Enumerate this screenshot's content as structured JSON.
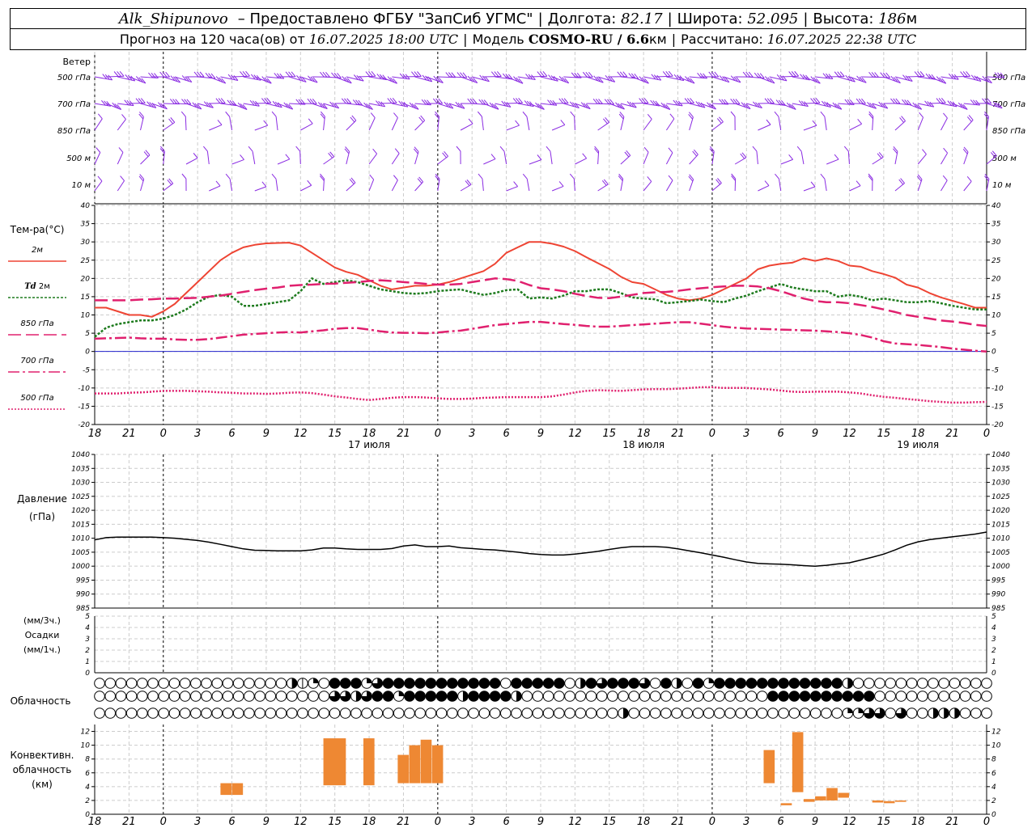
{
  "header": {
    "station": "Alk_Shipunovo",
    "provider": "– Предоставлено ФГБУ \"ЗапСиб УГМС\"",
    "lon_label": "Долгота:",
    "lon_value": "82.17",
    "lat_label": "Широта:",
    "lat_value": "52.095",
    "alt_label": "Высота:",
    "alt_value": "186",
    "alt_unit": "м",
    "forecast_label": "Прогноз на 120 часа(ов) от",
    "forecast_time": "16.07.2025 18:00 UTC",
    "model_label": "Модель",
    "model_name": "COSMO-RU / 6.6",
    "model_unit": "км",
    "calc_label": "Рассчитано:",
    "calc_time": "16.07.2025 22:38 UTC"
  },
  "time_axis": {
    "hour_labels": [
      "18",
      "21",
      "0",
      "3",
      "6",
      "9",
      "12",
      "15",
      "18",
      "21",
      "0",
      "3",
      "6",
      "9",
      "12",
      "15",
      "18",
      "21",
      "0",
      "3",
      "6",
      "9",
      "12",
      "15",
      "18",
      "21",
      "0"
    ],
    "day_labels": [
      {
        "text": "17 июля",
        "tick": 8
      },
      {
        "text": "18 июля",
        "tick": 16
      },
      {
        "text": "19 июля",
        "tick": 24
      }
    ],
    "midnight_ticks": [
      2,
      10,
      18,
      26
    ]
  },
  "wind_panel": {
    "title": "Ветер",
    "levels": [
      "500 гПа",
      "700 гПа",
      "850 гПа",
      "500 м",
      "10 м"
    ],
    "colors": {
      "barb": "#8a2be2"
    }
  },
  "chart_data": [
    {
      "type": "line",
      "title": "Тем-ра(°C)",
      "ylim": [
        -20,
        40
      ],
      "yticks": [
        -20,
        -15,
        -10,
        -5,
        0,
        5,
        10,
        15,
        20,
        25,
        30,
        35,
        40
      ],
      "x_hours": [
        0,
        78
      ],
      "series": [
        {
          "name": "2м",
          "color": "#ee4433",
          "dash": "",
          "width": 2,
          "values": [
            12,
            12,
            11,
            10,
            10,
            9.5,
            11,
            13,
            16,
            19,
            22,
            25,
            27,
            28.5,
            29.2,
            29.6,
            29.7,
            29.8,
            29,
            27,
            25,
            23,
            21.8,
            21,
            19.5,
            18,
            17,
            17.5,
            18,
            18,
            18.3,
            19,
            20,
            21,
            22,
            24,
            27,
            28.5,
            30,
            30,
            29.5,
            28.7,
            27.5,
            25.8,
            24.2,
            22.6,
            20.5,
            19,
            18.5,
            17,
            15.5,
            14.5,
            14,
            14.5,
            15.5,
            17,
            18.5,
            20,
            22.5,
            23.5,
            24,
            24.3,
            25.5,
            24.8,
            25.5,
            24.8,
            23.5,
            23.2,
            22,
            21.2,
            20.2,
            18.3,
            17.5,
            16,
            14.8,
            13.9,
            13,
            12,
            12
          ]
        },
        {
          "name": "Td 2м",
          "color": "#1e7b1e",
          "dash": "3,2",
          "width": 2.5,
          "values": [
            4,
            6.5,
            7.5,
            8,
            8.5,
            8.5,
            9,
            10,
            11.5,
            13.5,
            15,
            15.5,
            15,
            12.5,
            12.5,
            13,
            13.5,
            14,
            16.5,
            20,
            18.5,
            19,
            19.5,
            19,
            18,
            17,
            16.5,
            16,
            15.8,
            16,
            16.5,
            16.8,
            17,
            16.2,
            15.5,
            16,
            16.8,
            17,
            14.5,
            14.8,
            14.5,
            15.3,
            16.5,
            16.5,
            17,
            17,
            16,
            14.8,
            14.5,
            14.3,
            13.2,
            13.5,
            13.8,
            14.2,
            13.8,
            13.5,
            14.5,
            15.3,
            16.5,
            17.5,
            18.5,
            17.5,
            17,
            16.5,
            16.5,
            15,
            15.5,
            15,
            14,
            14.5,
            14,
            13.5,
            13.5,
            13.8,
            13.2,
            12.5,
            12,
            11.5,
            11.5
          ]
        },
        {
          "name": "850 гПа",
          "color": "#e0206e",
          "dash": "16,6",
          "width": 2.5,
          "values": [
            14,
            14,
            14,
            14,
            14.2,
            14.3,
            14.5,
            14.5,
            14.6,
            14.7,
            15,
            15.3,
            15.8,
            16.3,
            16.8,
            17.2,
            17.5,
            18,
            18.2,
            18.3,
            18.5,
            18.6,
            18.8,
            19,
            19.3,
            19.5,
            19.3,
            19,
            18.8,
            18.5,
            18.3,
            18.3,
            18.5,
            19,
            19.5,
            20,
            19.8,
            19.3,
            18.2,
            17.3,
            17,
            16.5,
            15.8,
            15.2,
            14.7,
            14.6,
            15,
            15.5,
            16,
            16.2,
            16.3,
            16.6,
            17,
            17.3,
            17.6,
            17.8,
            18,
            18,
            17.8,
            17.3,
            16.5,
            15.5,
            14.5,
            13.8,
            13.5,
            13.5,
            13.2,
            12.7,
            12.2,
            11.5,
            10.8,
            10,
            9.5,
            9,
            8.5,
            8.2,
            7.8,
            7.3,
            7
          ]
        },
        {
          "name": "700 гПа",
          "color": "#e0206e",
          "dash": "14,4,3,4",
          "width": 2.5,
          "values": [
            3.5,
            3.6,
            3.7,
            3.8,
            3.6,
            3.5,
            3.5,
            3.3,
            3.2,
            3.2,
            3.4,
            3.8,
            4.2,
            4.6,
            4.8,
            5,
            5.2,
            5.3,
            5.2,
            5.5,
            5.8,
            6.2,
            6.4,
            6.4,
            6,
            5.5,
            5.2,
            5.1,
            5.1,
            5,
            5.2,
            5.5,
            5.7,
            6.2,
            6.7,
            7.2,
            7.5,
            7.8,
            8.1,
            8.1,
            7.8,
            7.5,
            7.3,
            7,
            6.8,
            6.8,
            7,
            7.2,
            7.4,
            7.6,
            7.8,
            8,
            8,
            7.6,
            7.2,
            6.8,
            6.5,
            6.3,
            6.2,
            6.1,
            6,
            5.9,
            5.8,
            5.7,
            5.5,
            5.3,
            5,
            4.5,
            3.8,
            2.8,
            2.2,
            2,
            1.8,
            1.5,
            1.2,
            0.8,
            0.5,
            0.2,
            0
          ]
        },
        {
          "name": "500 гПа",
          "color": "#e0206e",
          "dash": "2,2",
          "width": 2.5,
          "values": [
            -11.5,
            -11.5,
            -11.5,
            -11.3,
            -11.2,
            -11,
            -10.8,
            -10.8,
            -10.8,
            -10.9,
            -11,
            -11.2,
            -11.3,
            -11.5,
            -11.5,
            -11.6,
            -11.5,
            -11.3,
            -11.2,
            -11.4,
            -11.8,
            -12.3,
            -12.6,
            -13,
            -13.3,
            -13,
            -12.7,
            -12.5,
            -12.5,
            -12.6,
            -12.8,
            -13,
            -13,
            -12.9,
            -12.7,
            -12.6,
            -12.5,
            -12.5,
            -12.5,
            -12.5,
            -12.3,
            -11.8,
            -11.2,
            -10.8,
            -10.6,
            -10.7,
            -10.8,
            -10.6,
            -10.4,
            -10.3,
            -10.3,
            -10.2,
            -10,
            -9.8,
            -9.8,
            -10,
            -10,
            -10,
            -10.2,
            -10.4,
            -10.7,
            -11,
            -11.1,
            -11,
            -11,
            -11,
            -11.2,
            -11.5,
            -12,
            -12.4,
            -12.7,
            -13,
            -13.3,
            -13.6,
            -13.8,
            -14,
            -14,
            -13.9,
            -13.8
          ]
        }
      ]
    },
    {
      "type": "line",
      "title": "Давление",
      "unit": "(гПа)",
      "ylim": [
        985,
        1040
      ],
      "yticks": [
        985,
        990,
        995,
        1000,
        1005,
        1010,
        1015,
        1020,
        1025,
        1030,
        1035,
        1040
      ],
      "x_hours": [
        0,
        78
      ],
      "series": [
        {
          "name": "",
          "color": "#000000",
          "values": [
            1009.4,
            1010.2,
            1010.4,
            1010.4,
            1010.4,
            1010.4,
            1010.2,
            1010,
            1009.6,
            1009.2,
            1008.6,
            1007.8,
            1007,
            1006.2,
            1005.7,
            1005.6,
            1005.5,
            1005.5,
            1005.5,
            1005.8,
            1006.5,
            1006.5,
            1006.2,
            1006,
            1006,
            1006,
            1006.3,
            1007.2,
            1007.6,
            1007,
            1007,
            1007.2,
            1006.6,
            1006.3,
            1006,
            1005.8,
            1005.4,
            1005,
            1004.5,
            1004.2,
            1004,
            1004,
            1004.3,
            1004.8,
            1005.3,
            1006,
            1006.6,
            1007,
            1007,
            1007,
            1006.8,
            1006.2,
            1005.5,
            1004.8,
            1004,
            1003.2,
            1002.3,
            1001.5,
            1001,
            1000.8,
            1000.7,
            1000.5,
            1000.2,
            1000,
            1000.3,
            1000.8,
            1001.2,
            1002.2,
            1003.2,
            1004.3,
            1005.8,
            1007.5,
            1008.7,
            1009.5,
            1010,
            1010.5,
            1011,
            1011.5,
            1012.2
          ]
        }
      ]
    },
    {
      "type": "bar",
      "title": "Осадки",
      "unit_top": "(мм/3ч.)",
      "unit_bottom": "(мм/1ч.)",
      "ylim": [
        0,
        5
      ],
      "yticks": [
        0,
        1,
        2,
        3,
        4,
        5
      ],
      "series": []
    },
    {
      "type": "bar",
      "title": "Конвективн. облачность (км)",
      "label_lines": [
        "Конвективн.",
        "облачность",
        "(км)"
      ],
      "ylim": [
        0,
        13
      ],
      "yticks": [
        0,
        2,
        4,
        6,
        8,
        10,
        12
      ],
      "color": "#ee8833",
      "bars": [
        {
          "t0": 11.0,
          "t1": 12.0,
          "base": 2.8,
          "top": 4.5
        },
        {
          "t0": 12.0,
          "t1": 13.0,
          "base": 2.8,
          "top": 4.5
        },
        {
          "t0": 20.0,
          "t1": 22.0,
          "base": 4.2,
          "top": 11.0
        },
        {
          "t0": 23.5,
          "t1": 24.5,
          "base": 4.2,
          "top": 11.0
        },
        {
          "t0": 26.5,
          "t1": 27.5,
          "base": 4.5,
          "top": 8.6
        },
        {
          "t0": 27.5,
          "t1": 28.5,
          "base": 4.5,
          "top": 10.0
        },
        {
          "t0": 28.5,
          "t1": 29.5,
          "base": 4.5,
          "top": 10.8
        },
        {
          "t0": 29.5,
          "t1": 30.5,
          "base": 4.5,
          "top": 10.0
        },
        {
          "t0": 58.5,
          "t1": 59.5,
          "base": 4.5,
          "top": 9.3
        },
        {
          "t0": 60.0,
          "t1": 61.0,
          "base": 1.3,
          "top": 1.6
        },
        {
          "t0": 61.0,
          "t1": 62.0,
          "base": 3.2,
          "top": 11.9
        },
        {
          "t0": 62.0,
          "t1": 63.0,
          "base": 1.8,
          "top": 2.2
        },
        {
          "t0": 63.0,
          "t1": 64.0,
          "base": 2.0,
          "top": 2.6
        },
        {
          "t0": 64.0,
          "t1": 65.0,
          "base": 2.0,
          "top": 3.8
        },
        {
          "t0": 65.0,
          "t1": 66.0,
          "base": 2.4,
          "top": 3.1
        },
        {
          "t0": 68.0,
          "t1": 69.0,
          "base": 1.7,
          "top": 2.0
        },
        {
          "t0": 69.0,
          "t1": 70.0,
          "base": 1.6,
          "top": 1.9
        },
        {
          "t0": 70.0,
          "t1": 71.0,
          "base": 1.8,
          "top": 2.0
        }
      ]
    }
  ],
  "cloud_panel": {
    "title": "Облачность",
    "rows": [
      "000000000000000000251044413444444444440444440243444304204144444444444420000000000000",
      "000000000000000000000033234414444424444200000000000000000000000444444444400000000000",
      "000000000000000000000000000000000000000000000000020000000000000000000011330300222000"
    ],
    "colors": {
      "stroke": "#000000",
      "fill": "#000000"
    }
  },
  "colors": {
    "grid": "#cccccc",
    "zero_line": "#2222cc",
    "accent_midnight": "#000000"
  }
}
